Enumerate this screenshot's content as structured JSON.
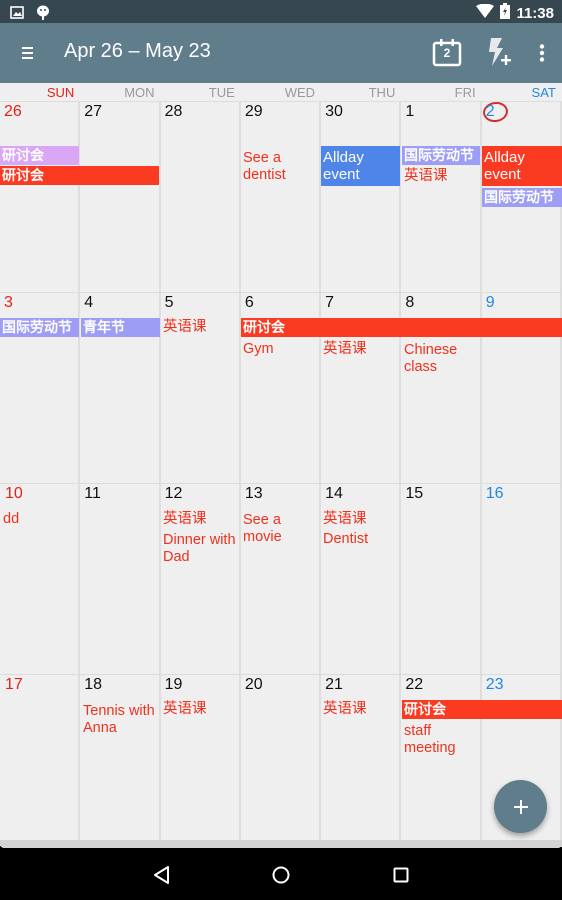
{
  "status_bar": {
    "time": "11:38",
    "left_icons": [
      "image-notification-icon",
      "android-debug-icon"
    ],
    "right_icons": [
      "wifi-icon",
      "battery-charging-icon"
    ]
  },
  "toolbar": {
    "title": "Apr 26 – May 23",
    "today_icon_day": "2",
    "actions": [
      "today-calendar-icon",
      "quick-add-icon",
      "more-options-icon"
    ]
  },
  "colors": {
    "toolbar": "#607d8b",
    "status_bar": "#37474f",
    "sunday": "#e62117",
    "saturday": "#1e88e5",
    "event_red": "#fb3a22",
    "event_purple": "#d9a7f5",
    "event_lavender": "#9d9df5",
    "event_blue": "#4f84e8",
    "event_text_red": "#f0311e"
  },
  "days_of_week": [
    "SUN",
    "MON",
    "TUE",
    "WED",
    "THU",
    "FRI",
    "SAT"
  ],
  "weeks": [
    {
      "days": [
        "26",
        "27",
        "28",
        "29",
        "30",
        "1",
        "2"
      ],
      "today_index": 6
    },
    {
      "days": [
        "3",
        "4",
        "5",
        "6",
        "7",
        "8",
        "9"
      ]
    },
    {
      "days": [
        "10",
        "11",
        "12",
        "13",
        "14",
        "15",
        "16"
      ]
    },
    {
      "days": [
        "17",
        "18",
        "19",
        "20",
        "21",
        "22",
        "23"
      ]
    }
  ],
  "events": {
    "w0_yantaohui_sun": "研讨会",
    "w0_yantaohui_span": "研讨会",
    "w0_dentist": "See a dentist",
    "w0_allday_thu": "Allday event",
    "w0_labor_fri": "国际劳动节",
    "w0_english_fri": "英语课",
    "w0_allday_sat": "Allday event",
    "w0_labor_sat": "国际劳动节",
    "w1_labor_sun": "国际劳动节",
    "w1_youth_mon": "青年节",
    "w1_english_tue": "英语课",
    "w1_yantaohui_span": "研讨会",
    "w1_gym": "Gym",
    "w1_english_thu": "英语课",
    "w1_chinese_class": "Chinese class",
    "w2_dd": "dd",
    "w2_english_tue": "英语课",
    "w2_dinner": "Dinner with Dad",
    "w2_movie": "See a movie",
    "w2_english_thu": "英语课",
    "w2_dentist": "Dentist",
    "w3_tennis": "Tennis with Anna",
    "w3_english_tue": "英语课",
    "w3_english_thu": "英语课",
    "w3_yantaohui_span": "研讨会",
    "w3_staff_meeting": "staff meeting"
  },
  "fab": {
    "label": "+",
    "icon": "add-event-icon"
  },
  "nav_bar": [
    "back-icon",
    "home-icon",
    "recents-icon"
  ]
}
